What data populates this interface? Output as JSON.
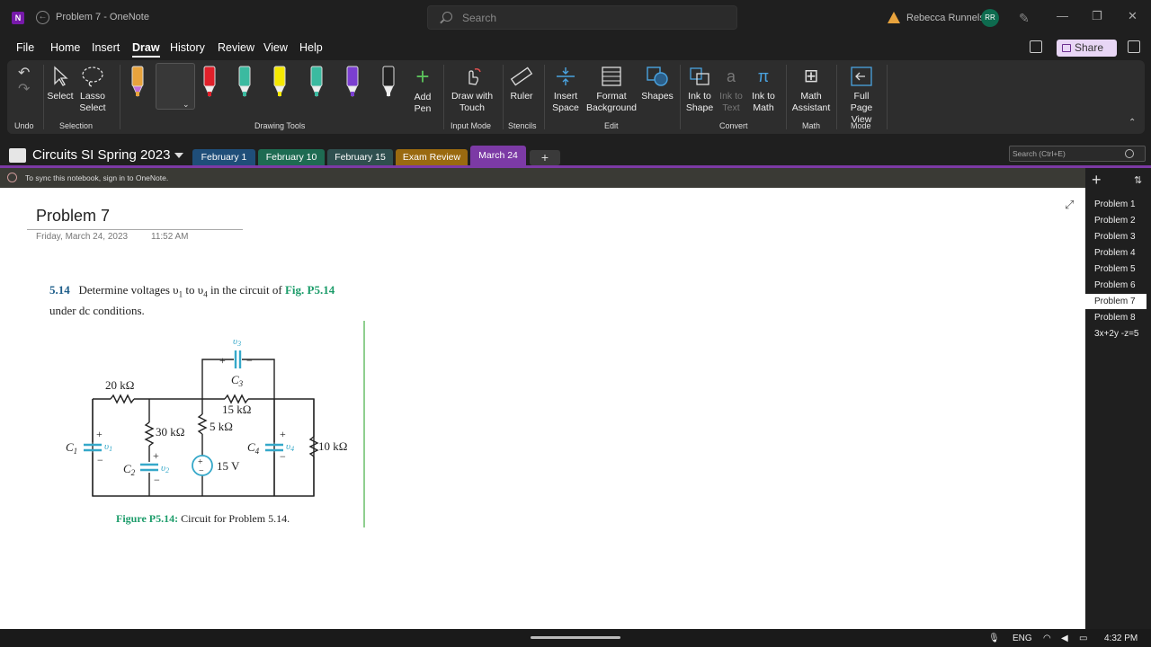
{
  "window": {
    "title": "Problem 7  -  OneNote",
    "search_placeholder": "Search",
    "user_name": "Rebecca Runnels",
    "user_initials": "RR"
  },
  "menu": {
    "items": [
      "File",
      "Home",
      "Insert",
      "Draw",
      "History",
      "Review",
      "View",
      "Help"
    ],
    "active": "Draw",
    "share_label": "Share"
  },
  "ribbon": {
    "undo_group": "Undo",
    "selection": {
      "select": "Select",
      "lasso": "Lasso Select",
      "group": "Selection"
    },
    "drawing_tools_group": "Drawing Tools",
    "pens": [
      {
        "color": "#e8a33d",
        "name": "orange-highlighter-pen"
      },
      {
        "color": "#f0f0f0",
        "name": "black-pen"
      },
      {
        "color": "#e0202a",
        "name": "red-pen"
      },
      {
        "color": "#3bbaa0",
        "name": "teal-pen"
      },
      {
        "color": "#f5e800",
        "name": "yellow-highlighter"
      },
      {
        "color": "#3bbaa0",
        "name": "teal-pen-2"
      },
      {
        "color": "#7b3fd0",
        "name": "purple-pen"
      },
      {
        "color": "#f0f0f0",
        "name": "black-pen-2"
      }
    ],
    "add_pen": "Add Pen",
    "input_mode": {
      "draw_touch": "Draw with Touch",
      "group": "Input Mode"
    },
    "stencils": {
      "ruler": "Ruler",
      "group": "Stencils"
    },
    "edit": {
      "insert_space": "Insert Space",
      "format_bg": "Format Background",
      "shapes": "Shapes",
      "group": "Edit"
    },
    "convert": {
      "ink_shape": "Ink to Shape",
      "ink_text": "Ink to Text",
      "ink_math": "Ink to Math",
      "group": "Convert"
    },
    "math": {
      "assistant": "Math Assistant",
      "group": "Math"
    },
    "mode": {
      "full_page": "Full Page View",
      "group": "Mode"
    }
  },
  "notebook": {
    "name": "Circuits SI Spring 2023",
    "tabs": [
      {
        "label": "February 1",
        "color": "#1f4e79"
      },
      {
        "label": "February 10",
        "color": "#1e6b52"
      },
      {
        "label": "February 15",
        "color": "#2f4f4f"
      },
      {
        "label": "Exam Review",
        "color": "#9a6a10"
      },
      {
        "label": "March 24",
        "color": "#7c3aa5"
      }
    ],
    "add_tab": "+",
    "search_placeholder": "Search (Ctrl+E)"
  },
  "sync_message": "To sync this notebook, sign in to OneNote.",
  "page": {
    "title": "Problem 7",
    "date": "Friday, March 24, 2023",
    "time": "11:52 AM",
    "problem_number": "5.14",
    "problem_text_1": "Determine voltages υ",
    "problem_text_2": " to υ",
    "problem_text_3": " in the circuit of ",
    "problem_fig": "Fig. P5.14",
    "problem_text_4": "under dc conditions.",
    "caption_fig": "Figure P5.14:",
    "caption_text": " Circuit for Problem 5.14.",
    "circuit_labels": {
      "r1": "20 kΩ",
      "r2": "30 kΩ",
      "r3": "5 kΩ",
      "r4": "15 kΩ",
      "r5": "10 kΩ",
      "src": "15 V",
      "c1": "C",
      "c2": "C",
      "c3": "C",
      "c4": "C",
      "v1": "υ",
      "v2": "υ",
      "v3": "υ",
      "v4": "υ"
    }
  },
  "page_list": {
    "items": [
      "Problem 1",
      "Problem 2",
      "Problem 3",
      "Problem 4",
      "Problem 5",
      "Problem 6",
      "Problem 7",
      "Problem 8",
      "3x+2y -z=5"
    ],
    "active_index": 6
  },
  "taskbar": {
    "language": "ENG",
    "clock": "4:32 PM"
  }
}
